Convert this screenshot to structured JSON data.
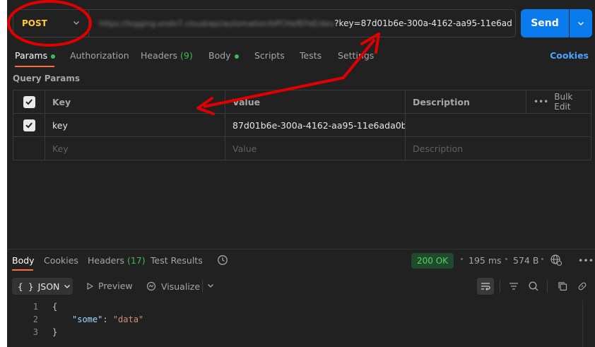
{
  "request": {
    "method": "POST",
    "url_blurred": "https://logging.endo7.cloud/api/automation/bPCHefEFeE/dev",
    "url_query": "?key=87d01b6e-300a-4162-aa95-11e6ad",
    "send_label": "Send"
  },
  "req_tabs": [
    {
      "label": "Params"
    },
    {
      "label": "Authorization"
    },
    {
      "label": "Headers",
      "count": "(9)"
    },
    {
      "label": "Body"
    },
    {
      "label": "Scripts"
    },
    {
      "label": "Tests"
    },
    {
      "label": "Settings"
    }
  ],
  "cookies_link": "Cookies",
  "query_params": {
    "title": "Query Params",
    "headers": {
      "key": "Key",
      "value": "Value",
      "description": "Description",
      "bulk_edit": "Bulk Edit"
    },
    "rows": [
      {
        "key": "key",
        "value": "87d01b6e-300a-4162-aa95-11e6ada0b...",
        "description": ""
      }
    ],
    "placeholders": {
      "key": "Key",
      "value": "Value",
      "description": "Description"
    }
  },
  "response": {
    "tabs": [
      {
        "label": "Body"
      },
      {
        "label": "Cookies"
      },
      {
        "label": "Headers",
        "count": "(17)"
      },
      {
        "label": "Test Results"
      }
    ],
    "status": "200 OK",
    "time": "195 ms",
    "size": "574 B",
    "format": "JSON",
    "preview_label": "Preview",
    "visualize_label": "Visualize",
    "body_lines": [
      {
        "n": "1",
        "text": "{"
      },
      {
        "n": "2",
        "key": "\"some\"",
        "value": "\"data\""
      },
      {
        "n": "3",
        "text": "}"
      }
    ]
  },
  "colors": {
    "method": "#ffcb3e",
    "send": "#097bed",
    "active_tab": "#ff6c37",
    "status_ok": "#56d364",
    "annotation": "#e00000"
  }
}
